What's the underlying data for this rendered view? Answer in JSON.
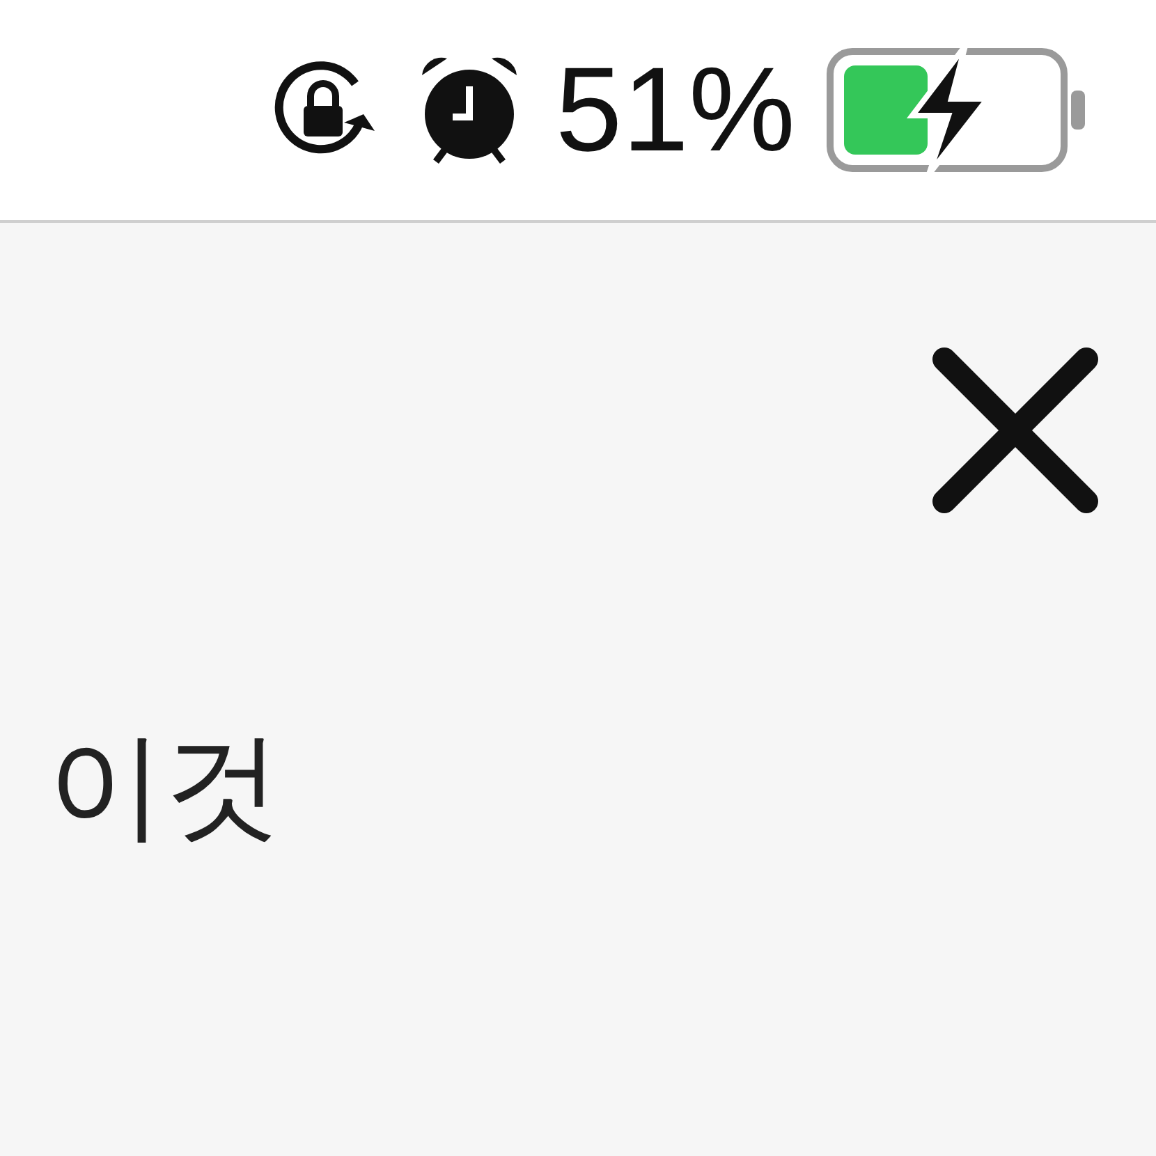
{
  "status_bar": {
    "battery_text": "51%"
  },
  "panel": {
    "text": "이것"
  }
}
